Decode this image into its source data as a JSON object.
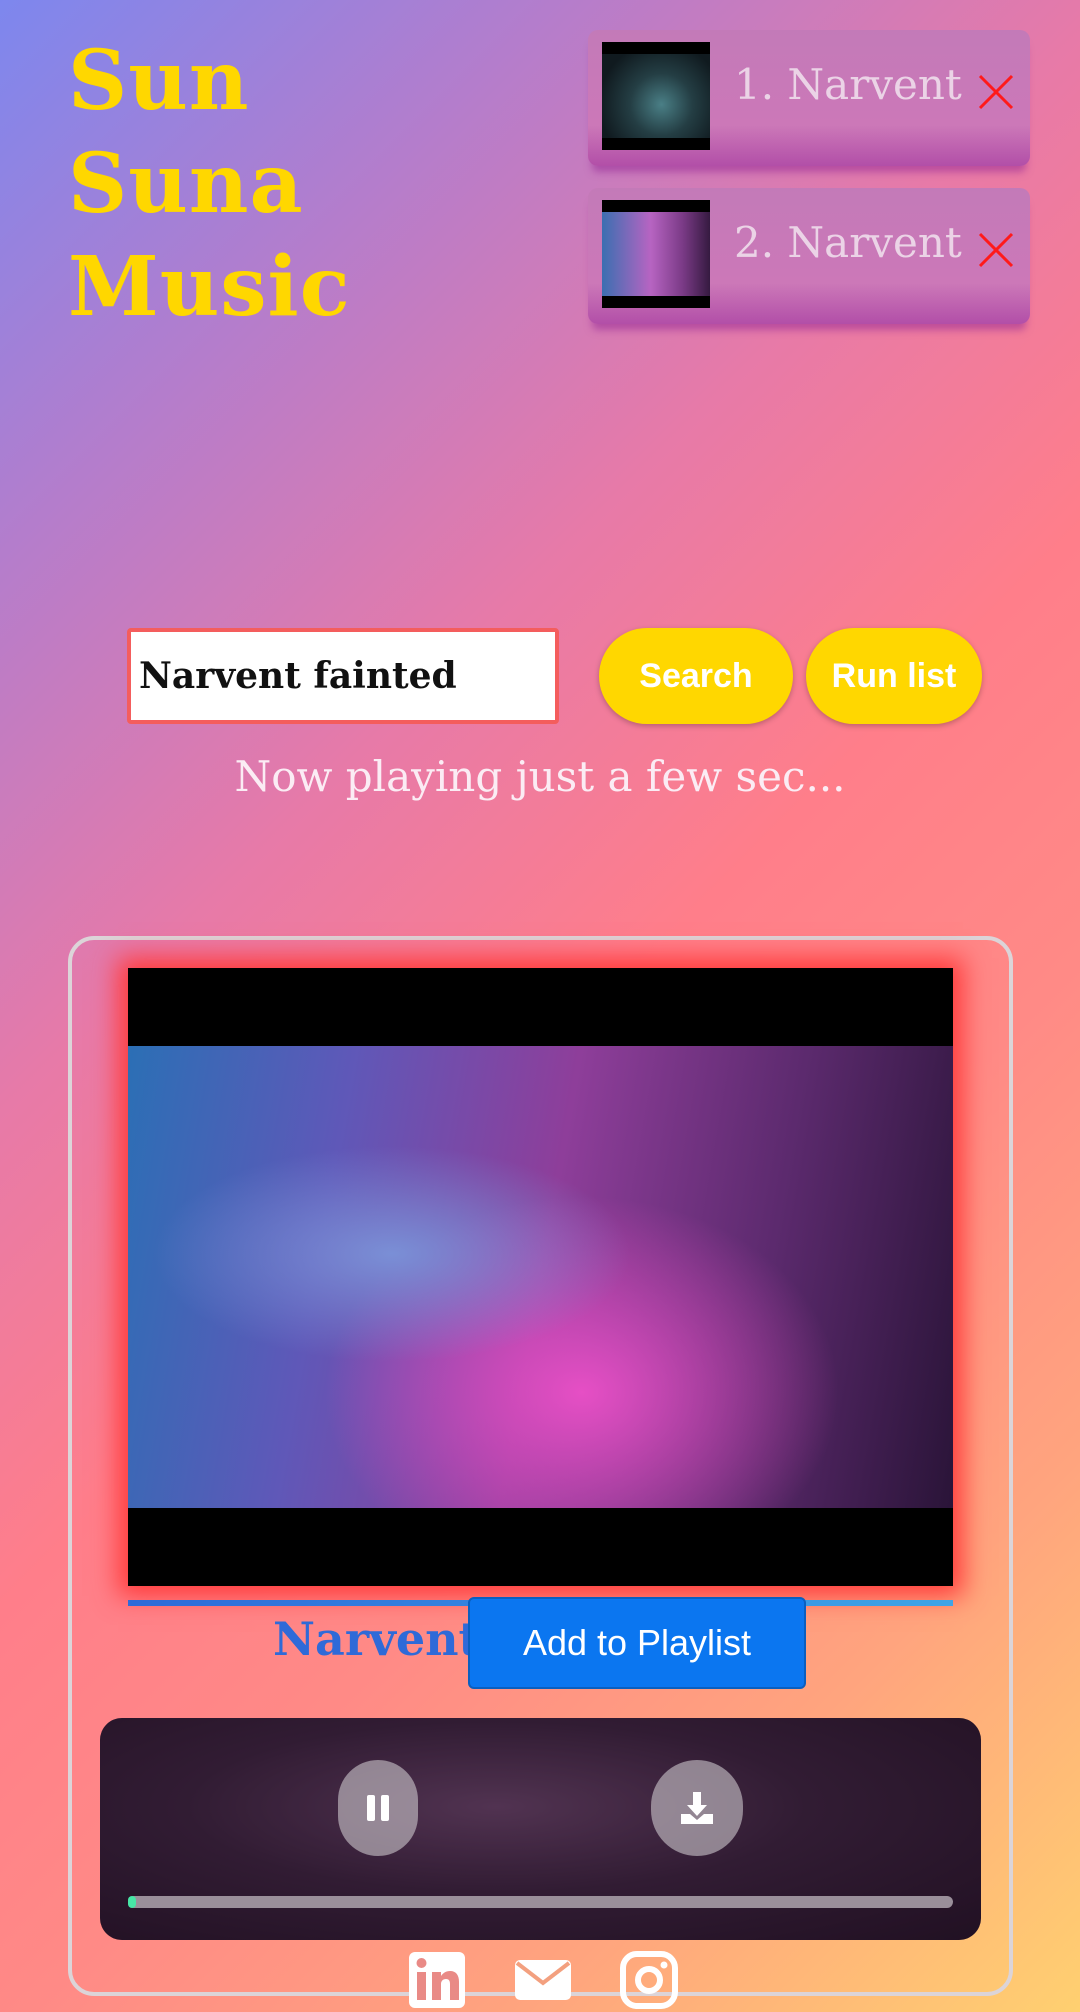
{
  "brand": {
    "line1": "Sun",
    "line2": "Suna",
    "line3": "Music"
  },
  "queue": {
    "items": [
      {
        "label": "1. Narvent",
        "remove_icon": "close-icon"
      },
      {
        "label": "2. Narvent",
        "remove_icon": "close-icon"
      }
    ]
  },
  "search": {
    "value": "Narvent fainted",
    "placeholder": ""
  },
  "buttons": {
    "search": "Search",
    "run_list": "Run list",
    "add_to_playlist": "Add to Playlist"
  },
  "status": "Now playing just a few sec...",
  "track": {
    "title": "Narvent"
  },
  "player": {
    "progress_fraction": 0.01,
    "pause_icon": "pause-icon",
    "download_icon": "download-icon"
  },
  "footer": {
    "icons": [
      "linkedin-icon",
      "mail-icon",
      "instagram-icon"
    ]
  },
  "colors": {
    "brand": "#ffd700",
    "accent_blue": "#0b76f0",
    "remove_red": "#ff1a1a",
    "seek": "#47e6a6"
  }
}
